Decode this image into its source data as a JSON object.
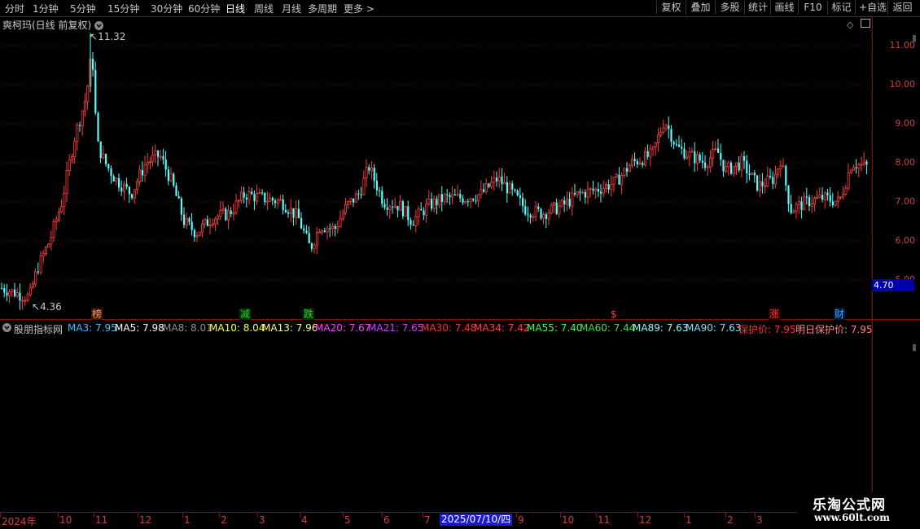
{
  "toolbar": {
    "periods": [
      "分时",
      "1分钟",
      "5分钟",
      "15分钟",
      "30分钟",
      "60分钟",
      "日线",
      "周线",
      "月线",
      "多周期",
      "更多"
    ],
    "more_chevron": ">",
    "actions": [
      "复权",
      "叠加",
      "多股",
      "统计",
      "画线",
      "F10",
      "标记",
      "+自选",
      "返回"
    ]
  },
  "main_chart": {
    "title": "爽柯玛(日线 前复权)",
    "high_label": "11.32",
    "low_label": "4.36",
    "current_price_tag": "4.70",
    "y_ticks": [
      "11.00",
      "10.00",
      "9.00",
      "8.00",
      "7.00",
      "6.00",
      "5.00"
    ],
    "events": [
      {
        "text": "榜",
        "color": "#ff9966"
      },
      {
        "text": "减",
        "color": "#33cc33"
      },
      {
        "text": "跌",
        "color": "#33cc33"
      },
      {
        "text": "$",
        "color": "#ff3333"
      },
      {
        "text": "涨",
        "color": "#ff3333"
      },
      {
        "text": "财",
        "color": "#33aaff"
      }
    ]
  },
  "indicator": {
    "name": "股朋指标网",
    "values": [
      {
        "label": "MA3: 7.95",
        "color": "#40c0ff"
      },
      {
        "label": "MA5: 7.98",
        "color": "#ffffff"
      },
      {
        "label": "MA8: 8.01",
        "color": "#909090"
      },
      {
        "label": "MA10: 8.04",
        "color": "#ffff40"
      },
      {
        "label": "MA13: 7.96",
        "color": "#ffff80"
      },
      {
        "label": "MA20: 7.67",
        "color": "#ff40ff"
      },
      {
        "label": "MA21: 7.65",
        "color": "#d040ff"
      },
      {
        "label": "MA30: 7.48",
        "color": "#ff3030"
      },
      {
        "label": "MA34: 7.42",
        "color": "#ff4040"
      },
      {
        "label": "MA55: 7.40",
        "color": "#40ff40"
      },
      {
        "label": "MA60: 7.44",
        "color": "#40e040"
      },
      {
        "label": "MA89: 7.63",
        "color": "#80ffff"
      },
      {
        "label": "MA90: 7.63",
        "color": "#80e0ff"
      },
      {
        "label": "保护价: 7.95",
        "color": "#ff3030"
      },
      {
        "label": "明日保护价: 7.95",
        "color": "#ff8080"
      }
    ]
  },
  "time_axis": {
    "labels": [
      "2024年",
      "10",
      "11",
      "12",
      "1",
      "2",
      "3",
      "4",
      "5",
      "6",
      "7",
      "9",
      "10",
      "11",
      "12",
      "1",
      "2",
      "3"
    ],
    "cursor_date": "2025/07/10/四"
  },
  "watermark": {
    "line1": "乐淘公式网",
    "line2": "www.60lt.com"
  },
  "colors": {
    "up": "#ff3c3c",
    "down": "#54ffff",
    "axis": "#a00000",
    "background": "#000000"
  }
}
